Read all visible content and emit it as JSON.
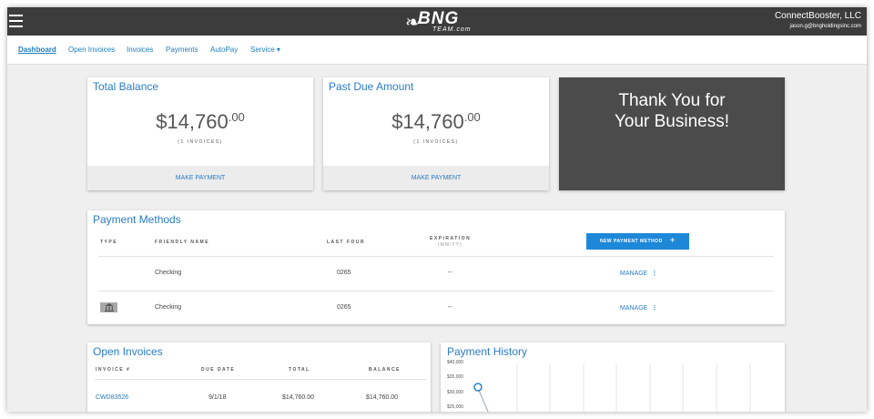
{
  "header": {
    "logo_text": "BNG",
    "logo_sub": "TEAM.com",
    "company_name": "ConnectBooster, LLC",
    "company_email": "jason.g@bngholdingsinc.com"
  },
  "nav": {
    "items": [
      {
        "label": "Dashboard",
        "active": true
      },
      {
        "label": "Open Invoices"
      },
      {
        "label": "Invoices"
      },
      {
        "label": "Payments"
      },
      {
        "label": "AutoPay"
      },
      {
        "label": "Service ▾"
      }
    ]
  },
  "total_balance": {
    "title": "Total Balance",
    "amount_main": "$14,760",
    "amount_cents": ".00",
    "invoice_count": "(1 INVOICES)",
    "action": "MAKE PAYMENT"
  },
  "past_due": {
    "title": "Past Due Amount",
    "amount_main": "$14,760",
    "amount_cents": ".00",
    "invoice_count": "(1 INVOICES)",
    "action": "MAKE PAYMENT"
  },
  "thanks": {
    "line1": "Thank You for",
    "line2": "Your Business!"
  },
  "payment_methods": {
    "title": "Payment Methods",
    "columns": {
      "type": "TYPE",
      "friendly_name": "FRIENDLY NAME",
      "last_four": "LAST FOUR",
      "expiration": "EXPIRATION",
      "expiration_sub": "(MM/YY)"
    },
    "new_button": "NEW PAYMENT METHOD",
    "rows": [
      {
        "type_icon": "",
        "name": "Checking",
        "last_four": "0265",
        "expiration": "--",
        "action": "MANAGE"
      },
      {
        "type_icon": "bank-icon",
        "name": "Checking",
        "last_four": "0265",
        "expiration": "--",
        "action": "MANAGE"
      }
    ]
  },
  "open_invoices": {
    "title": "Open Invoices",
    "columns": [
      "INVOICE #",
      "DUE DATE",
      "TOTAL",
      "BALANCE"
    ],
    "rows": [
      {
        "invoice": "CWD83526",
        "due_date": "9/1/18",
        "total": "$14,760.00",
        "balance": "$14,760.00"
      }
    ]
  },
  "payment_history": {
    "title": "Payment History",
    "y_ticks": [
      "$40,000",
      "$35,000",
      "$30,000",
      "$25,000"
    ]
  },
  "colors": {
    "accent": "#2a7cc7",
    "topbar": "#3c3c3c",
    "thanks_bg": "#4b4b4b",
    "button": "#1e88d8"
  }
}
